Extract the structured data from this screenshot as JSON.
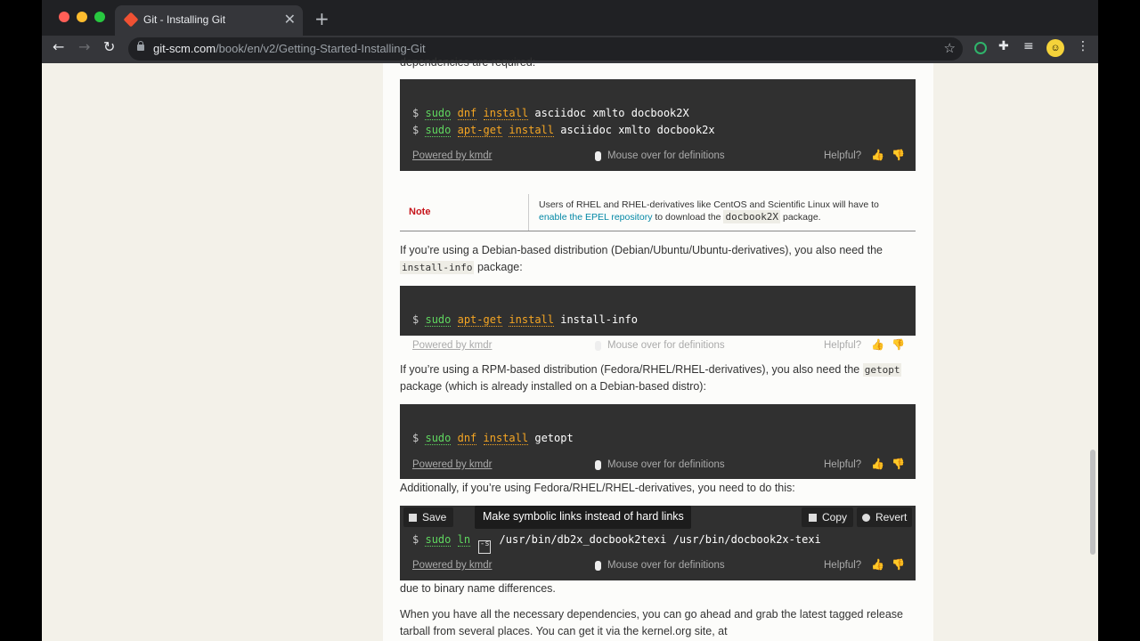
{
  "browser": {
    "tab_title": "Git - Installing Git",
    "close_glyph": "✕",
    "new_tab_glyph": "+",
    "url_domain": "git-scm.com",
    "url_path": "/book/en/v2/Getting-Started-Installing-Git",
    "light_colors": [
      "#ff5f57",
      "#febc2e",
      "#28c840"
    ]
  },
  "page": {
    "top_text": "dependencies are required:",
    "block1": {
      "line1": {
        "prompt": "$",
        "cmd1": "sudo",
        "cmd2": "dnf",
        "cmd3": "install",
        "args": "asciidoc xmlto docbook2X"
      },
      "line2": {
        "prompt": "$",
        "cmd1": "sudo",
        "cmd2": "apt-get",
        "cmd3": "install",
        "args": "asciidoc xmlto docbook2x"
      }
    },
    "footer": {
      "powered": "Powered by kmdr",
      "mouseover": "Mouse over for definitions",
      "helpful": "Helpful?"
    },
    "note": {
      "label": "Note",
      "text_before": "Users of RHEL and RHEL-derivatives like CentOS and Scientific Linux will have to",
      "link": "enable the EPEL repository",
      "text_mid": "to download the",
      "code": "docbook2X",
      "text_after": "package."
    },
    "para1": {
      "text": "If you’re using a Debian-based distribution (Debian/Ubuntu/Ubuntu-derivatives), you also need the",
      "code": "install-info",
      "after": "package:"
    },
    "block2": {
      "prompt": "$",
      "cmd1": "sudo",
      "cmd2": "apt-get",
      "cmd3": "install",
      "args": "install-info"
    },
    "para2": {
      "text": "If you’re using a RPM-based distribution (Fedora/RHEL/RHEL-derivatives), you also need the",
      "code": "getopt",
      "after": "package (which is already installed on a Debian-based distro):"
    },
    "block3": {
      "prompt": "$",
      "cmd1": "sudo",
      "cmd2": "dnf",
      "cmd3": "install",
      "args": "getopt"
    },
    "para3": "Additionally, if you’re using Fedora/RHEL/RHEL-derivatives, you need to do this:",
    "block4": {
      "save": "Save",
      "copy": "Copy",
      "revert": "Revert",
      "tooltip": "Make symbolic links instead of hard links",
      "prompt": "$",
      "cmd1": "sudo",
      "cmd2": "ln",
      "flag_icon": "-s",
      "args": "/usr/bin/db2x_docbook2texi /usr/bin/docbook2x-texi"
    },
    "para4": "due to binary name differences.",
    "para5_line1": "When you have all the necessary dependencies, you can go ahead and grab the latest tagged release",
    "para5_line2": "tarball from several places. You can get it via the kernel.org site, at"
  }
}
